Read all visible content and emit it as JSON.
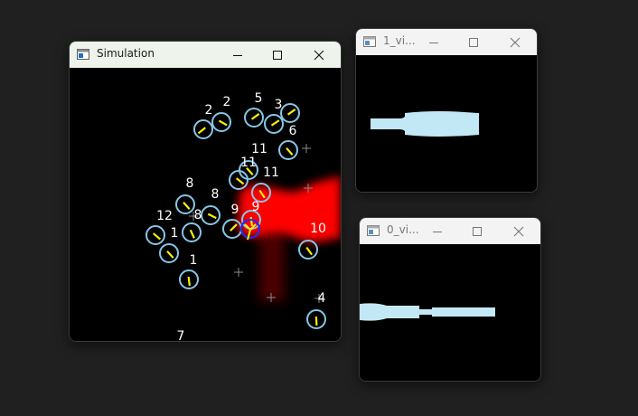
{
  "windows": {
    "simulation": {
      "title": "Simulation"
    },
    "view1": {
      "title": "1_vi..."
    },
    "view0": {
      "title": "0_vi..."
    }
  },
  "labels": [
    "2",
    "2",
    "5",
    "3",
    "6",
    "11",
    "11",
    "11",
    "8",
    "8",
    "9",
    "9",
    "12",
    "8",
    "1",
    "10",
    "1",
    "4",
    "7"
  ],
  "colors": {
    "agent_ring": "#86c6e6",
    "selected_ring": "#1a2eff",
    "heading_line": "#f2f200",
    "field": "#ff0000",
    "view_shape": "#c2e8f6"
  }
}
